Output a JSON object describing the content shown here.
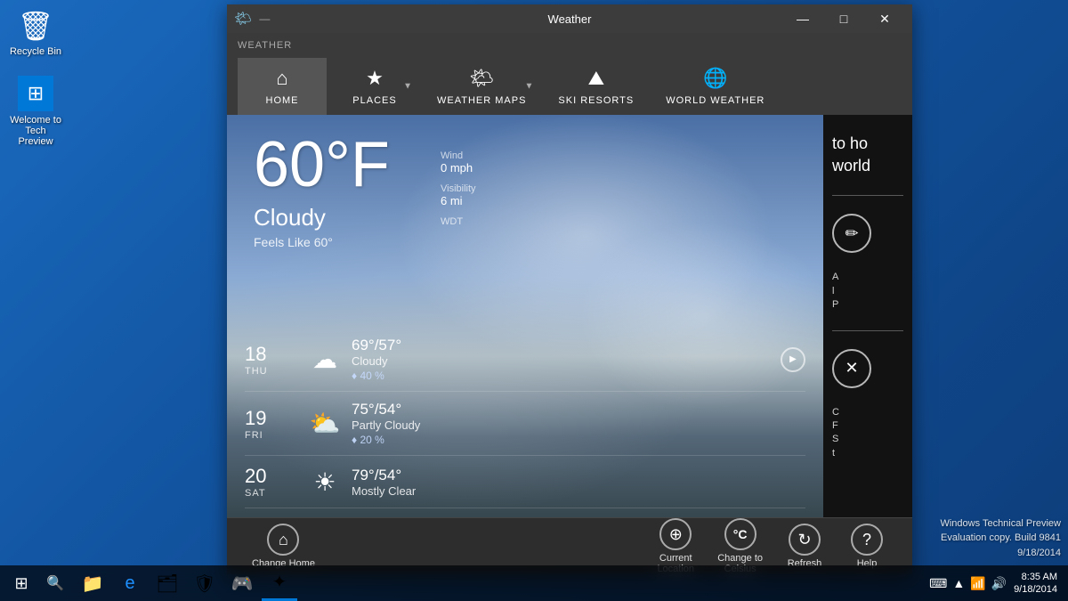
{
  "desktop": {
    "recycle_bin": {
      "label": "Recycle Bin",
      "icon": "🗑"
    },
    "welcome": {
      "label": "Welcome to\nTech Preview",
      "icon": "⊞"
    }
  },
  "window": {
    "title": "Weather",
    "icon": "🌤",
    "dots": "—",
    "controls": {
      "minimize": "—",
      "maximize": "□",
      "close": "✕"
    }
  },
  "nav": {
    "section_label": "WEATHER",
    "items": [
      {
        "label": "HOME",
        "icon": "⌂",
        "has_arrow": false
      },
      {
        "label": "PLACES",
        "icon": "★",
        "has_arrow": true
      },
      {
        "label": "WEATHER MAPS",
        "icon": "🌤",
        "has_arrow": true
      },
      {
        "label": "SKI RESORTS",
        "icon": "⛰",
        "has_arrow": false
      },
      {
        "label": "WORLD WEATHER",
        "icon": "🌐",
        "has_arrow": false
      }
    ]
  },
  "weather": {
    "temperature": "60°F",
    "condition": "Cloudy",
    "feels_like": "Feels Like 60°",
    "wind_label": "Wind",
    "wind_value": "0 mph",
    "visibility_label": "Visibility",
    "visibility_value": "6 mi",
    "wdt_label": "WDT"
  },
  "forecast": [
    {
      "date": "18",
      "dow": "THU",
      "icon": "☁",
      "hi_lo": "69°/57°",
      "condition": "Cloudy",
      "precip": "♦ 40 %",
      "has_play": true
    },
    {
      "date": "19",
      "dow": "FRI",
      "icon": "⛅",
      "hi_lo": "75°/54°",
      "condition": "Partly Cloudy",
      "precip": "♦ 20 %",
      "has_play": false
    },
    {
      "date": "20",
      "dow": "SAT",
      "icon": "☀",
      "hi_lo": "79°/54°",
      "condition": "Mostly Clear",
      "precip": "",
      "has_play": false
    }
  ],
  "right_panel": {
    "text_line1": "to ho",
    "text_line2": "world",
    "edit_label": "✏",
    "delete_label": "✕",
    "note1": "A\nl\nP",
    "note2": "C\nF\nS\nt"
  },
  "toolbar": {
    "items": [
      {
        "label": "Change Home",
        "icon": "⌂"
      },
      {
        "label": "Current\nLocation",
        "icon": "⊕"
      },
      {
        "label": "Change to\nCelsius",
        "icon": "°C"
      },
      {
        "label": "Refresh",
        "icon": "↻"
      },
      {
        "label": "Help",
        "icon": "?"
      }
    ]
  },
  "taskbar": {
    "start_icon": "⊞",
    "search_icon": "🔍",
    "apps": [
      {
        "icon": "🌐",
        "label": "IE"
      },
      {
        "icon": "📁",
        "label": "Explorer"
      },
      {
        "icon": "🛡",
        "label": "Security"
      },
      {
        "icon": "🎮",
        "label": "Games"
      },
      {
        "icon": "✦",
        "label": "Weather",
        "active": true
      }
    ],
    "time": "8:35 AM",
    "date": "9/18/2014"
  },
  "watermark": {
    "line1": "Windows Technical Preview",
    "line2": "Evaluation copy. Build 9841",
    "line3": "9/18/2014"
  }
}
